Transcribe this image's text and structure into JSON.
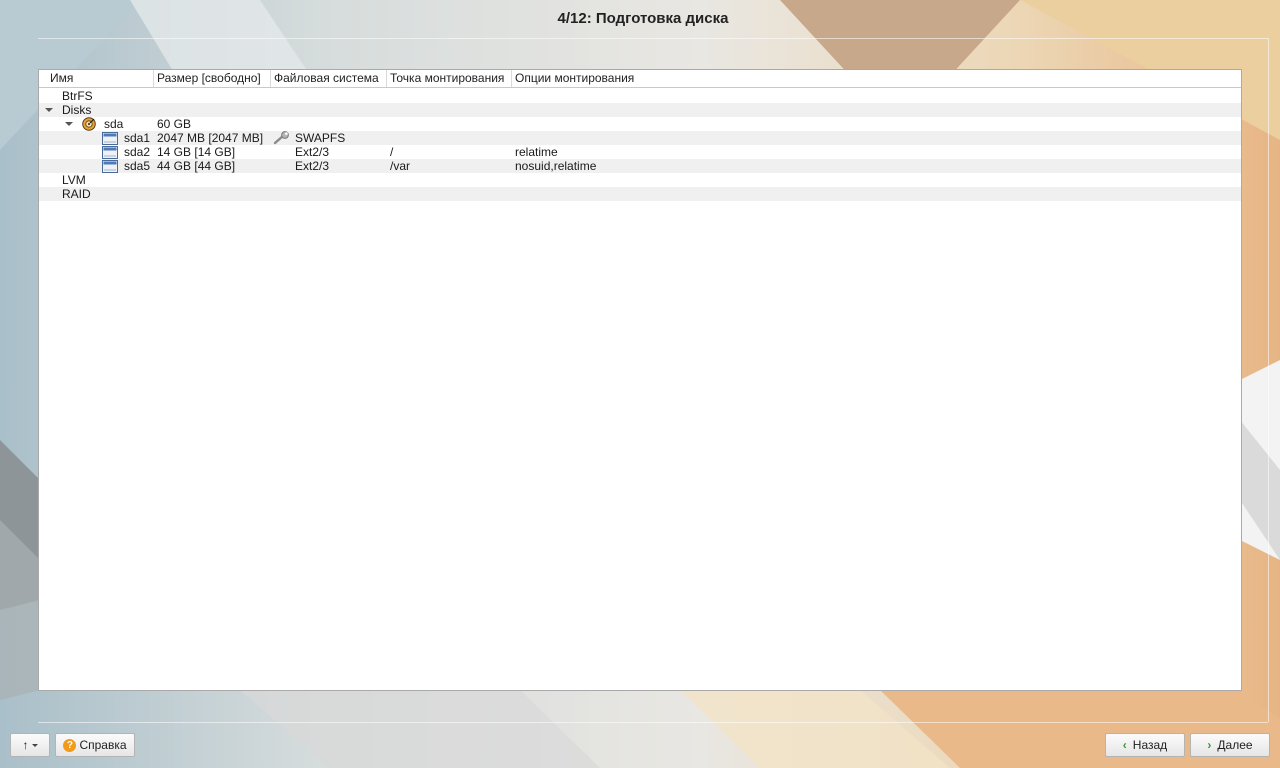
{
  "title": "4/12: Подготовка диска",
  "columns": [
    "Имя",
    "Размер [свободно]",
    "Файловая система",
    "Точка монтирования",
    "Опции монтирования"
  ],
  "rows": [
    {
      "name": "BtrFS",
      "size": "",
      "fs": "",
      "mount": "",
      "options": ""
    },
    {
      "name": "Disks",
      "size": "",
      "fs": "",
      "mount": "",
      "options": ""
    },
    {
      "name": "sda",
      "size": "60 GB",
      "fs": "",
      "mount": "",
      "options": ""
    },
    {
      "name": "sda1",
      "size": "2047 MB [2047 MB]",
      "fs": "SWAPFS",
      "mount": "",
      "options": ""
    },
    {
      "name": "sda2",
      "size": "14 GB [14 GB]",
      "fs": "Ext2/3",
      "mount": "/",
      "options": "relatime"
    },
    {
      "name": "sda5",
      "size": "44 GB [44 GB]",
      "fs": "Ext2/3",
      "mount": "/var",
      "options": "nosuid,relatime"
    },
    {
      "name": "LVM",
      "size": "",
      "fs": "",
      "mount": "",
      "options": ""
    },
    {
      "name": "RAID",
      "size": "",
      "fs": "",
      "mount": "",
      "options": ""
    }
  ],
  "icons": {
    "expander": "triangle-down-icon",
    "disk": "hard-disk-icon",
    "partition": "partition-icon",
    "swap": "wrench-icon",
    "help": "question-icon",
    "back": "chevron-left-icon",
    "next": "chevron-right-icon",
    "menu": "up-arrow-icon"
  },
  "buttons": {
    "help": "Справка",
    "back": "Назад",
    "next": "Далее",
    "menu_glyph": "↑"
  },
  "colors": {
    "accent_green": "#2f9e2f",
    "help_orange": "#f29a1a"
  }
}
